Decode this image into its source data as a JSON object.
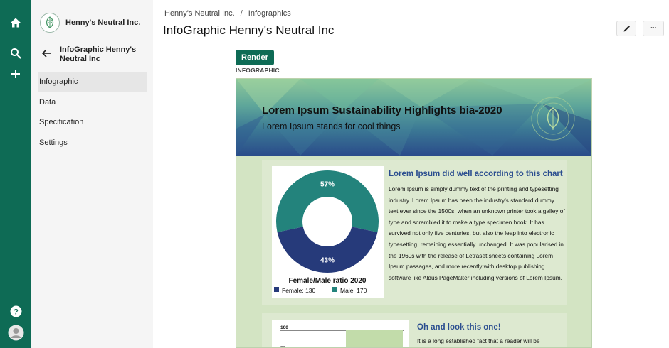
{
  "rail": {
    "icons": [
      "home-icon",
      "search-icon",
      "plus-icon",
      "help-icon",
      "avatar"
    ]
  },
  "sidebar": {
    "org_name": "Henny's Neutral Inc.",
    "project_title": "InfoGraphic Henny's Neutral Inc",
    "items": [
      {
        "label": "Infographic",
        "active": true
      },
      {
        "label": "Data",
        "active": false
      },
      {
        "label": "Specification",
        "active": false
      },
      {
        "label": "Settings",
        "active": false
      }
    ]
  },
  "breadcrumb": {
    "org": "Henny's Neutral Inc.",
    "sep": "/",
    "section": "Infographics"
  },
  "page": {
    "title": "InfoGraphic Henny's Neutral Inc",
    "edit_icon": "pencil-icon",
    "more_label": "···"
  },
  "render_button": "Render",
  "infographic_label": "INFOGRAPHIC",
  "infographic": {
    "banner_title": "Lorem Ipsum Sustainability Highlights bia-2020",
    "banner_subtitle": "Lorem Ipsum stands for cool things",
    "card1": {
      "title": "Lorem Ipsum did well according to this chart",
      "body": "Lorem Ipsum is simply dummy text of the printing and typesetting industry. Lorem Ipsum has been the industry's standard dummy text ever since the 1500s, when an unknown printer took a galley of type and scrambled it to make a type specimen book. It has survived not only five centuries, but also the leap into electronic typesetting, remaining essentially unchanged. It was popularised in the 1960s with the release of Letraset sheets containing Lorem Ipsum passages, and more recently with desktop publishing software like Aldus PageMaker including versions of Lorem Ipsum."
    },
    "card2": {
      "title": "Oh and look this one!",
      "body": "It is a long established fact that a reader will be"
    }
  },
  "chart_data": [
    {
      "type": "pie",
      "title": "Female/Male ratio 2020",
      "categories": [
        "Female: 130",
        "Male: 170"
      ],
      "values": [
        130,
        170
      ],
      "percent_labels": [
        "43%",
        "57%"
      ],
      "colors": [
        "#263a7a",
        "#23837c"
      ],
      "legend": "bottom"
    },
    {
      "type": "bar",
      "y_ticks": [
        "100",
        "75"
      ],
      "ylim": [
        0,
        100
      ]
    }
  ]
}
